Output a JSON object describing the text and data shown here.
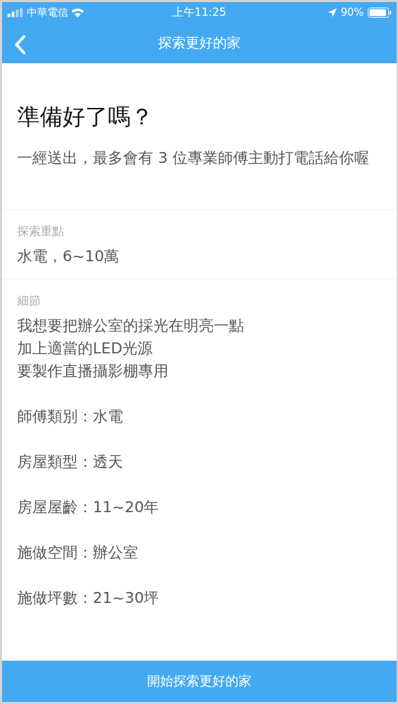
{
  "status_bar": {
    "carrier": "中華電信",
    "time": "上午11:25",
    "battery": "90%"
  },
  "nav": {
    "title": "探索更好的家"
  },
  "intro": {
    "heading": "準備好了嗎？",
    "text": "一經送出，最多會有 3 位專業師傅主動打電話給你喔"
  },
  "sections": [
    {
      "label": "探索重點",
      "lines": [
        "水電，6~10萬"
      ]
    },
    {
      "label": "細節",
      "lines": [
        "我想要把辦公室的採光在明亮一點",
        "加上適當的LED光源",
        "要製作直播攝影棚專用"
      ],
      "items": [
        "師傅類別：水電",
        "房屋類型：透天",
        "房屋屋齡：11~20年",
        "施做空間：辦公室",
        "施做坪數：21~30坪"
      ]
    }
  ],
  "submit": {
    "label": "開始探索更好的家"
  }
}
